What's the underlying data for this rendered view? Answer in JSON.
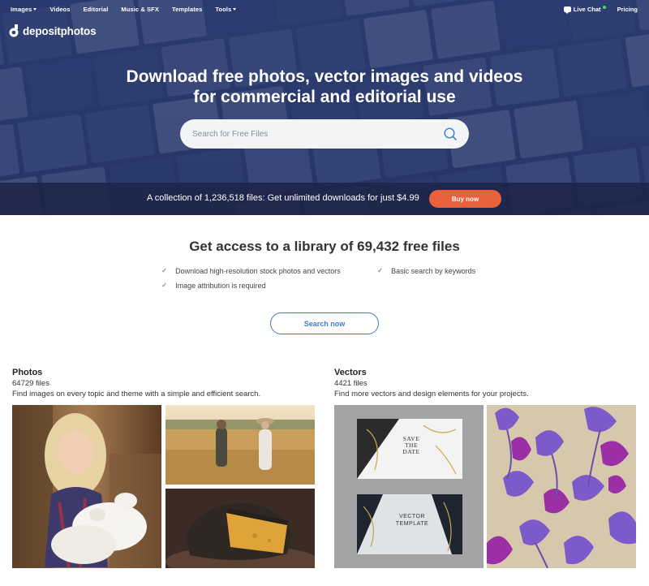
{
  "nav": {
    "left": [
      {
        "label": "Images",
        "dropdown": true
      },
      {
        "label": "Videos",
        "dropdown": false
      },
      {
        "label": "Editorial",
        "dropdown": false
      },
      {
        "label": "Music & SFX",
        "dropdown": false
      },
      {
        "label": "Templates",
        "dropdown": false
      },
      {
        "label": "Tools",
        "dropdown": true
      }
    ],
    "live_chat": "Live Chat",
    "pricing": "Pricing"
  },
  "brand": {
    "name": "depositphotos"
  },
  "hero": {
    "title_line1": "Download free photos, vector images and videos",
    "title_line2": "for commercial and editorial use",
    "search_placeholder": "Search for Free Files"
  },
  "promo": {
    "text": "A collection of 1,236,518 files: Get unlimited downloads for just $4.99",
    "button": "Buy now"
  },
  "library": {
    "title": "Get access to a library of 69,432 free files",
    "features": [
      "Download high-resolution stock photos and vectors",
      "Basic search by keywords",
      "Image attribution is required"
    ],
    "button": "Search now"
  },
  "categories": {
    "photos": {
      "title": "Photos",
      "count": "64729 files",
      "description": "Find images on every topic and theme with a simple and efficient search."
    },
    "vectors": {
      "title": "Vectors",
      "count": "4421 files",
      "description": "Find more vectors and design elements for your projects.",
      "card1": [
        "SAVE",
        "THE",
        "DATE"
      ],
      "card2": [
        "VECTOR",
        "TEMPLATE"
      ]
    }
  },
  "colors": {
    "accent_orange": "#e8603c",
    "link_blue": "#3f7ec7",
    "hero_blue": "#2f3f73"
  }
}
